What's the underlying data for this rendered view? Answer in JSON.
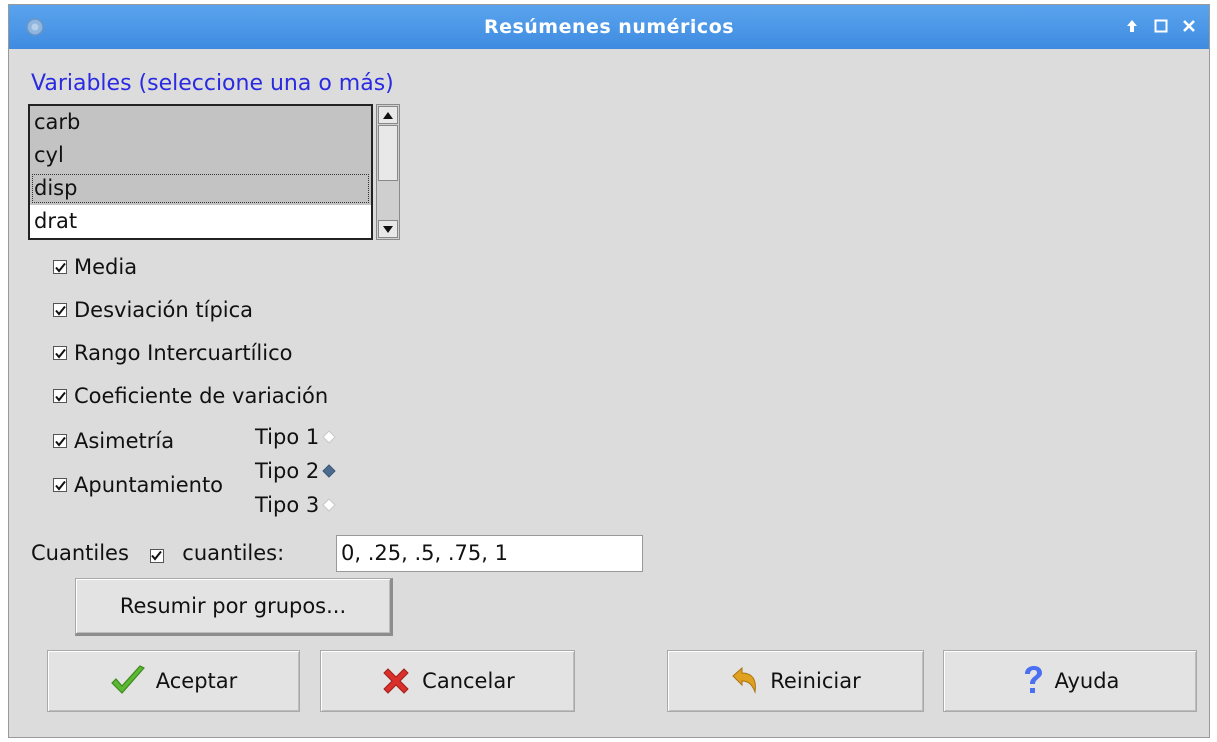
{
  "window": {
    "title": "Resúmenes numéricos"
  },
  "variables": {
    "label": "Variables (seleccione una o más)",
    "items": [
      {
        "label": "carb",
        "selected": true
      },
      {
        "label": "cyl",
        "selected": true
      },
      {
        "label": "disp",
        "selected": true,
        "focused": true
      },
      {
        "label": "drat",
        "selected": false
      }
    ]
  },
  "stats": {
    "media": {
      "label": "Media",
      "checked": true
    },
    "desviacion": {
      "label": "Desviación típica",
      "checked": true
    },
    "rango": {
      "label": "Rango Intercuartílico",
      "checked": true
    },
    "coef": {
      "label": "Coeficiente de variación",
      "checked": true
    },
    "asimetria": {
      "label": "Asimetría",
      "checked": true
    },
    "apuntamiento": {
      "label": "Apuntamiento",
      "checked": true
    }
  },
  "tipo": {
    "options": [
      {
        "label": "Tipo 1",
        "selected": false
      },
      {
        "label": "Tipo 2",
        "selected": true
      },
      {
        "label": "Tipo 3",
        "selected": false
      }
    ]
  },
  "cuantiles": {
    "label": "Cuantiles",
    "checked": true,
    "field_label": "cuantiles:",
    "value": "0, .25, .5, .75, 1"
  },
  "buttons": {
    "group": "Resumir por grupos...",
    "ok": "Aceptar",
    "cancel": "Cancelar",
    "reset": "Reiniciar",
    "help": "Ayuda"
  },
  "colors": {
    "titlebar": "#4a97e8",
    "label_blue": "#2a2ae0",
    "ok_icon": "#5bb832",
    "cancel_icon": "#d9302b",
    "reset_icon": "#e0a020",
    "help_icon": "#4a6ff0"
  }
}
